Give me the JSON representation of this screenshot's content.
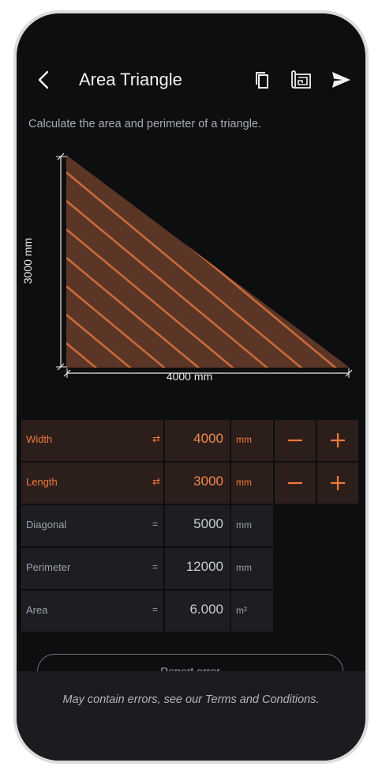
{
  "colors": {
    "accent": "#ef7a3d",
    "triangle_fill": "#5b3526",
    "hatch": "#c86b3b",
    "screen_bg": "#0d0e10",
    "input_row_bg": "#2c1e1b",
    "output_row_bg": "#1c1e21"
  },
  "header": {
    "title": "Area Triangle",
    "icons": [
      "back-arrow-icon",
      "copy-icon",
      "blueprint-icon",
      "send-icon"
    ]
  },
  "description": "Calculate the area and perimeter of a triangle.",
  "diagram": {
    "height_label": "3000 mm",
    "width_label": "4000 mm"
  },
  "inputs": [
    {
      "label": "Width",
      "symbol": "⇄",
      "value": "4000",
      "unit": "mm",
      "minus": "−",
      "plus": "+"
    },
    {
      "label": "Length",
      "symbol": "⇄",
      "value": "3000",
      "unit": "mm",
      "minus": "−",
      "plus": "+"
    }
  ],
  "outputs": [
    {
      "label": "Diagonal",
      "symbol": "=",
      "value": "5000",
      "unit": "mm"
    },
    {
      "label": "Perimeter",
      "symbol": "=",
      "value": "12000",
      "unit": "mm"
    },
    {
      "label": "Area",
      "symbol": "=",
      "value": "6.000",
      "unit": "m²"
    }
  ],
  "report_button": "Report error",
  "footer": "May contain errors, see our Terms and Conditions."
}
